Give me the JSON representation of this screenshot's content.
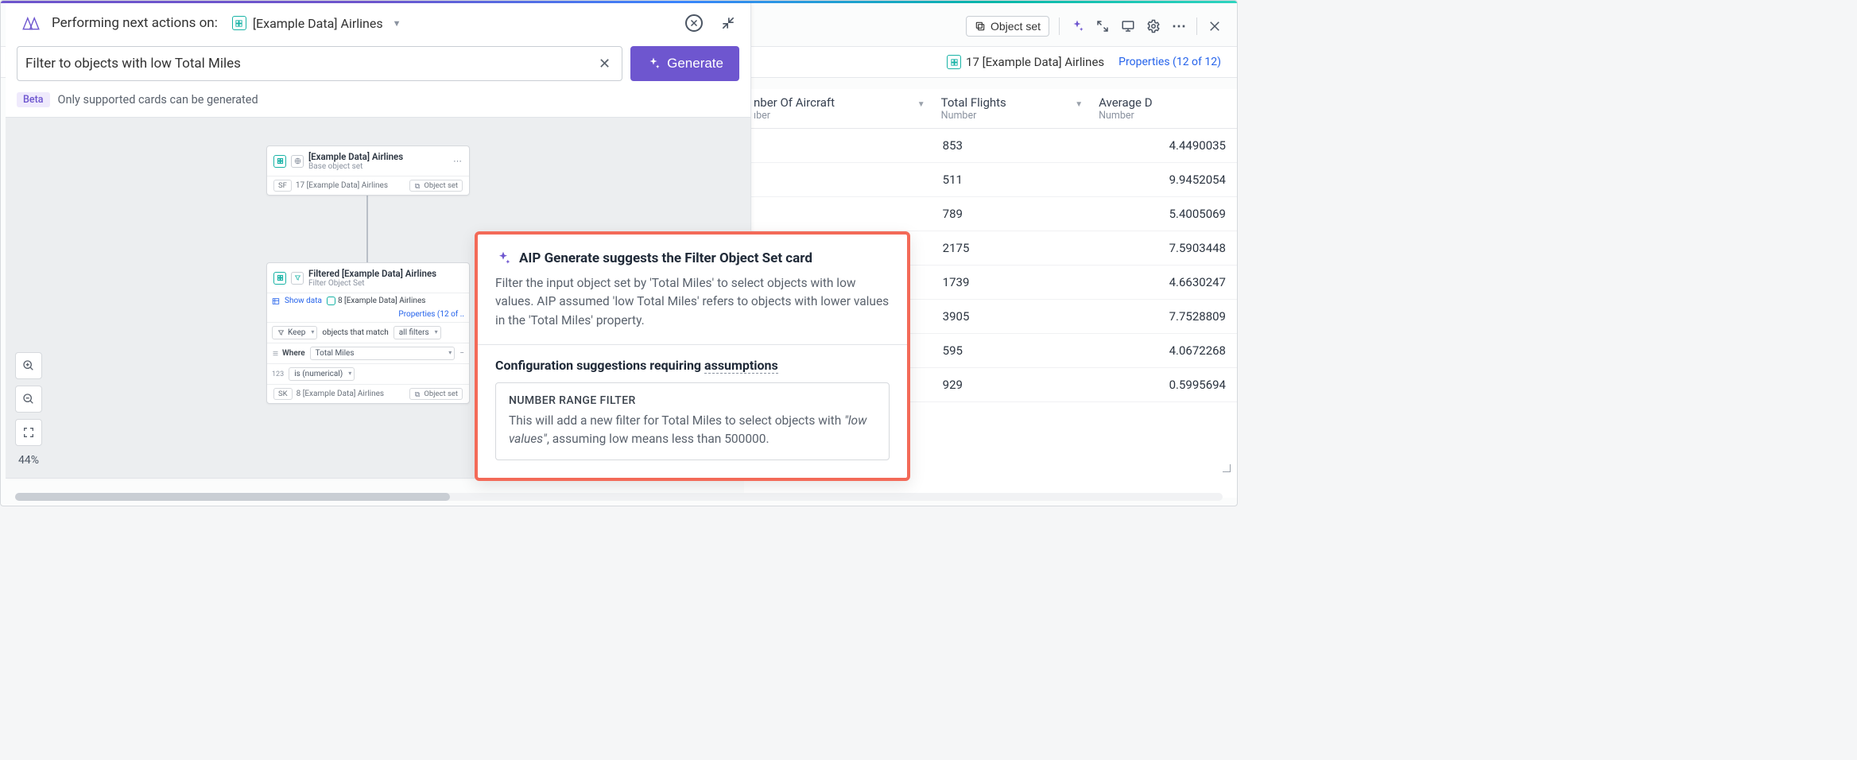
{
  "header": {
    "title": "Performing next actions on:",
    "dataset": "[Example Data] Airlines"
  },
  "prompt": {
    "text": "Filter to objects with low Total Miles",
    "generate_label": "Generate",
    "beta_label": "Beta",
    "beta_note": "Only supported cards can be generated"
  },
  "zoom": {
    "pct": "44%"
  },
  "card_a": {
    "title": "[Example Data] Airlines",
    "subtitle": "Base object set",
    "footer_count": "17 [Example Data] Airlines",
    "footer_tag": "Object set",
    "sf_label": "SF"
  },
  "card_b": {
    "title": "Filtered [Example Data] Airlines",
    "subtitle": "Filter Object Set",
    "show_data": "Show data",
    "chip": "8 [Example Data] Airlines",
    "props_link": "Properties (12 of ..",
    "keep": "Keep",
    "match_text": "objects that match",
    "all_filters": "all filters",
    "where": "Where",
    "where_field": "Total Miles",
    "is_num": "is (numerical)",
    "num_prefix": "123",
    "footer_count": "8 [Example Data] Airlines",
    "footer_tag": "Object set",
    "sk_label": "SK"
  },
  "popover": {
    "title": "AIP Generate suggests the Filter Object Set card",
    "desc": "Filter the input object set by 'Total Miles' to select objects with low values. AIP assumed 'low Total Miles' refers to objects with lower values in the 'Total Miles' property.",
    "subhead_pre": "Configuration suggestions requiring ",
    "subhead_under": "assumptions",
    "assump_title": "NUMBER RANGE FILTER",
    "assump_body_pre": "This will add a new filter for Total Miles to select objects with ",
    "assump_body_em": "\"low values\"",
    "assump_body_post": ", assuming low means less than 500000."
  },
  "right": {
    "btn_objectset": "Object set",
    "chip_text": "17 [Example Data] Airlines",
    "props_link": "Properties (12 of 12)"
  },
  "table": {
    "columns": [
      {
        "name": "nber Of Aircraft",
        "type": "ıber"
      },
      {
        "name": "Total Flights",
        "type": "Number"
      },
      {
        "name": "Average D",
        "type": "Number"
      }
    ],
    "rows": [
      {
        "flights": "853",
        "avg": "4.4490035"
      },
      {
        "flights": "511",
        "avg": "9.9452054"
      },
      {
        "flights": "789",
        "avg": "5.4005069"
      },
      {
        "flights": "2175",
        "avg": "7.5903448"
      },
      {
        "flights": "1739",
        "avg": "4.6630247"
      },
      {
        "flights": "3905",
        "avg": "7.7528809"
      },
      {
        "flights": "595",
        "avg": "4.0672268"
      },
      {
        "flights": "929",
        "avg": "0.5995694"
      }
    ]
  }
}
